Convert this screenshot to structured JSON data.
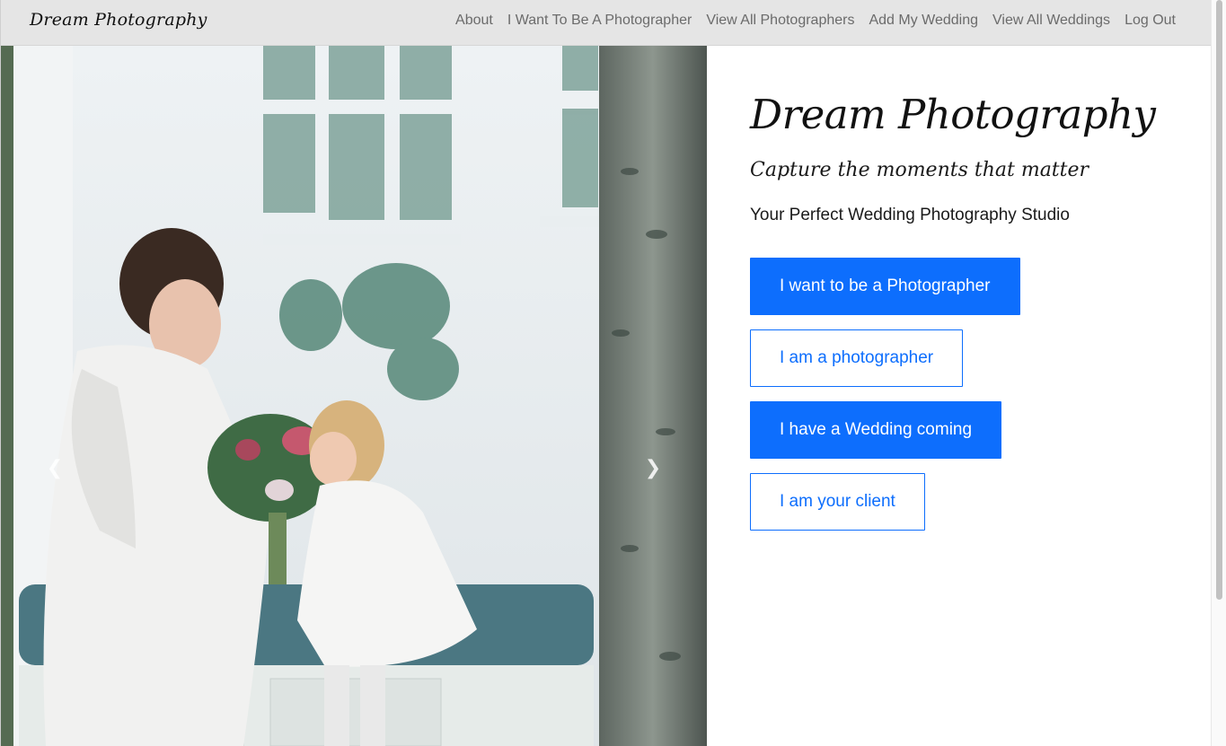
{
  "navbar": {
    "brand": "Dream Photography",
    "links": [
      "About",
      "I Want To Be A Photographer",
      "View All Photographers",
      "Add My Wedding",
      "View All Weddings",
      "Log Out"
    ]
  },
  "carousel": {
    "prev_icon": "chevron-left-icon",
    "next_icon": "chevron-right-icon"
  },
  "hero": {
    "title": "Dream Photography",
    "tagline": "Capture the moments that matter",
    "subtitle": "Your Perfect Wedding Photography Studio",
    "buttons": [
      "I want to be a Photographer",
      "I am a photographer",
      "I have a Wedding coming",
      "I am your client"
    ]
  },
  "colors": {
    "primary": "#0d6efd",
    "navbar_bg": "#e5e5e5"
  }
}
